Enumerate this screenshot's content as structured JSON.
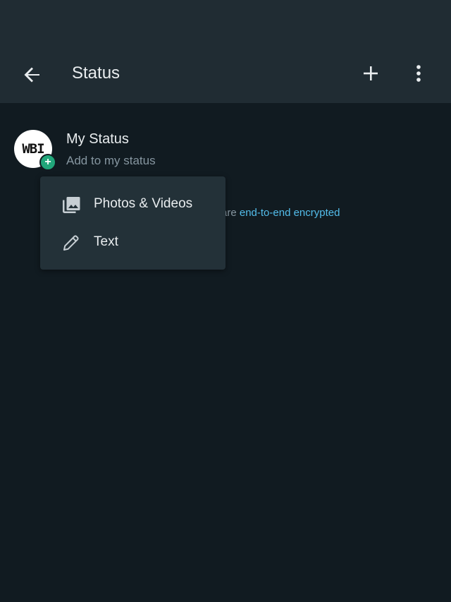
{
  "header": {
    "title": "Status",
    "back_icon": "arrow-left-icon",
    "add_icon": "plus-icon",
    "menu_icon": "more-vertical-icon"
  },
  "my_status": {
    "name": "My Status",
    "subtitle": "Add to my status",
    "avatar_text": "WBI",
    "badge": "+"
  },
  "encryption_note": {
    "prefix": "are ",
    "link": "end-to-end encrypted"
  },
  "dropdown": {
    "items": [
      {
        "label": "Photos & Videos",
        "icon": "photo-library-icon"
      },
      {
        "label": "Text",
        "icon": "pencil-icon"
      }
    ]
  },
  "colors": {
    "background": "#111b21",
    "header": "#202c33",
    "menu": "#233138",
    "accent": "#21a67a",
    "link": "#53bdeb"
  }
}
